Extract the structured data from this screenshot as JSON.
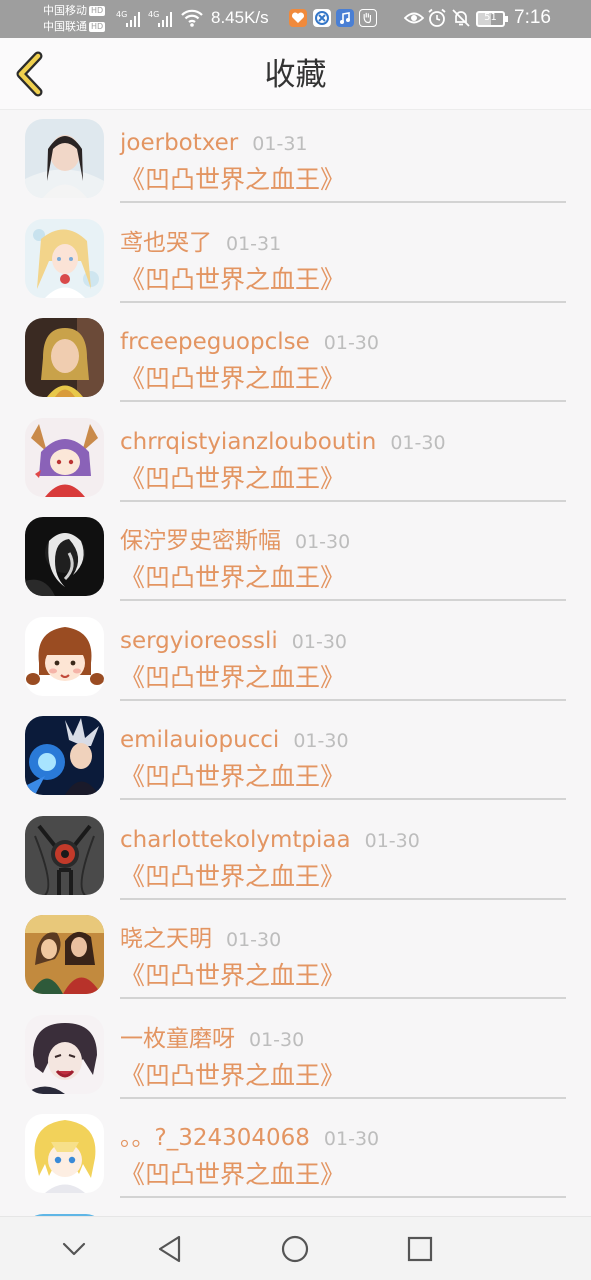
{
  "status_bar": {
    "carrier1": "中国移动",
    "carrier2": "中国联通",
    "hd": "HD",
    "network": "4G",
    "speed": "8.45K/s",
    "battery_level": "51",
    "time": "7:16"
  },
  "header": {
    "title": "收藏"
  },
  "entries": [
    {
      "name": "joerbotxer",
      "date": "01-31",
      "book": "《凹凸世界之血王》"
    },
    {
      "name": "鸢也哭了",
      "date": "01-31",
      "book": "《凹凸世界之血王》"
    },
    {
      "name": "frceepeguopclse",
      "date": "01-30",
      "book": "《凹凸世界之血王》"
    },
    {
      "name": "chrrqistyianzlouboutin",
      "date": "01-30",
      "book": "《凹凸世界之血王》"
    },
    {
      "name": "保泞罗史密斯幅",
      "date": "01-30",
      "book": "《凹凸世界之血王》"
    },
    {
      "name": "sergyioreossli",
      "date": "01-30",
      "book": "《凹凸世界之血王》"
    },
    {
      "name": "emilauiopucci",
      "date": "01-30",
      "book": "《凹凸世界之血王》"
    },
    {
      "name": "charlottekolymtpiaa",
      "date": "01-30",
      "book": "《凹凸世界之血王》"
    },
    {
      "name": "晓之天明",
      "date": "01-30",
      "book": "《凹凸世界之血王》"
    },
    {
      "name": "一枚童磨呀",
      "date": "01-30",
      "book": "《凹凸世界之血王》"
    },
    {
      "name": "。。?_324304068",
      "date": "01-30",
      "book": "《凹凸世界之血王》"
    }
  ],
  "icons": {
    "back": "chevron-left-icon",
    "nav": [
      "chevron-down-icon",
      "back-triangle-icon",
      "home-circle-icon",
      "recents-square-icon"
    ]
  },
  "colors": {
    "accent": "#e39562",
    "date": "#bdbdbd",
    "back_arrow": "#f0d04e",
    "status_bar": "#9e9e9e"
  }
}
